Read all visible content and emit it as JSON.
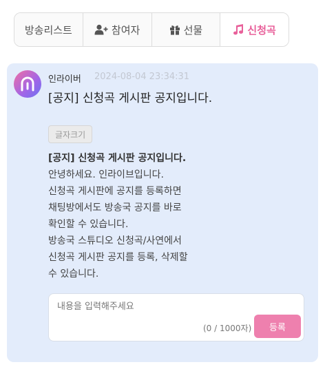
{
  "tabs": [
    {
      "label": "방송리스트",
      "icon": "list-icon"
    },
    {
      "label": "참여자",
      "icon": "user-plus-icon"
    },
    {
      "label": "선물",
      "icon": "gift-icon"
    },
    {
      "label": "신청곡",
      "icon": "music-note-icon"
    }
  ],
  "active_tab": "신청곡",
  "colors": {
    "accent": "#e8609a",
    "panel_bg": "#e3ecfb",
    "submit_bg": "#ee80ae"
  },
  "post": {
    "author": "인라이버",
    "date": "2024-08-04 23:34:31",
    "title": "[공지] 신청곡 게시판 공지입니다.",
    "font_size_button": "글자크기",
    "body": {
      "heading": "[공지] 신청곡 게시판 공지입니다.",
      "lines": [
        "안녕하세요. 인라이브입니다.",
        "신청곡 게시판에 공지를 등록하면",
        "채팅방에서도 방송국 공지를 바로",
        "확인할 수 있습니다.",
        "방송국 스튜디오 신청곡/사연에서",
        "신청곡 게시판 공지를 등록, 삭제할",
        "수 있습니다."
      ]
    }
  },
  "comment": {
    "placeholder": "내용을 입력해주세요",
    "value": "",
    "counter": "(0 / 1000자)",
    "submit_label": "등록"
  }
}
